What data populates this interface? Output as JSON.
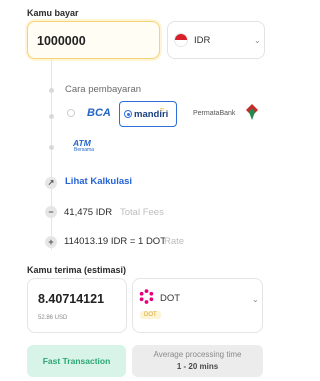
{
  "pay": {
    "label": "Kamu bayar",
    "amount": "1000000",
    "currency": "IDR",
    "flag_icon": "indonesia-flag-icon"
  },
  "payment_method": {
    "label": "Cara pembayaran",
    "banks": [
      {
        "name": "BCA",
        "selected": false
      },
      {
        "name": "mandiri",
        "selected": true
      },
      {
        "name": "PermataBank",
        "selected": false
      },
      {
        "name": "ATM",
        "sub": "Bersama",
        "selected": false
      }
    ],
    "accent": "#2f6fdc"
  },
  "calc": {
    "link_label": "Lihat Kalkulasi"
  },
  "fees": {
    "total_fee_value": "41,475 IDR",
    "total_fee_label": "Total Fees",
    "rate_value": "114013.19 IDR = 1 DOT",
    "rate_label": "Rate"
  },
  "receive": {
    "label": "Kamu terima (estimasi)",
    "amount": "8.40714121",
    "amount_usd": "52.86 USD",
    "currency": "DOT",
    "badge": "DOT"
  },
  "footer": {
    "fast_label": "Fast Transaction",
    "avg_label": "Average processing time",
    "avg_value": "1 - 20 mins"
  }
}
